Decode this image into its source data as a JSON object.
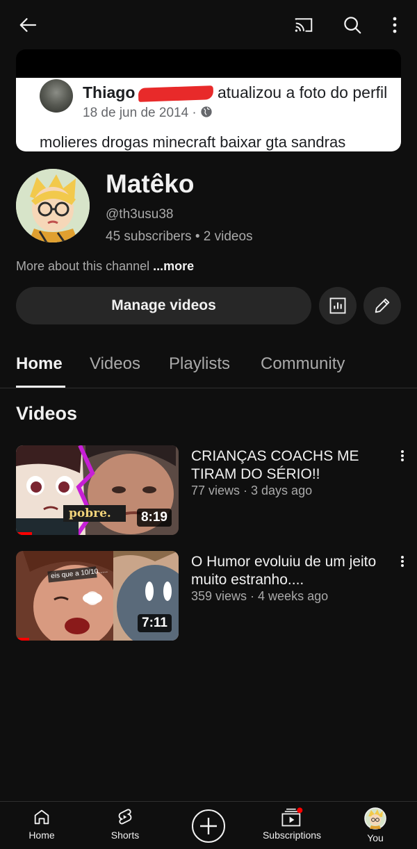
{
  "topbar": {
    "icons": [
      "back-arrow-icon",
      "cast-icon",
      "search-icon",
      "more-vert-icon"
    ]
  },
  "banner": {
    "post_name": "Thiago",
    "post_action": "atualizou a foto do perfil",
    "post_date": "18 de jun de 2014 ·",
    "post_text": "molieres drogas minecraft baixar gta sandras"
  },
  "channel": {
    "name": "Matêko",
    "handle": "@th3usu38",
    "stats": "45 subscribers • 2 videos",
    "more_about": "More about this channel",
    "more_link": "...more"
  },
  "actions": {
    "manage_videos": "Manage videos",
    "icons": [
      "analytics-icon",
      "edit-pencil-icon"
    ]
  },
  "tabs": [
    {
      "label": "Home"
    },
    {
      "label": "Videos"
    },
    {
      "label": "Playlists"
    },
    {
      "label": "Community"
    }
  ],
  "section": {
    "title": "Videos"
  },
  "videos": [
    {
      "title": "CRIANÇAS COACHS ME TIRAM DO SÉRIO!!",
      "meta": "77 views · 3 days ago",
      "duration": "8:19",
      "thumb_caption": "pobre.",
      "watched_fraction": 0.1
    },
    {
      "title": "O Humor evoluiu de um jeito muito estranho....",
      "meta": "359 views · 4 weeks ago",
      "duration": "7:11",
      "thumb_caption": "eis que a 10/10.....",
      "watched_fraction": 0.08
    }
  ],
  "bottom_nav": [
    {
      "label": "Home",
      "icon": "home-icon"
    },
    {
      "label": "Shorts",
      "icon": "shorts-icon"
    },
    {
      "label": "",
      "icon": "create-plus-icon"
    },
    {
      "label": "Subscriptions",
      "icon": "subscriptions-icon"
    },
    {
      "label": "You",
      "icon": "avatar-icon"
    }
  ],
  "colors": {
    "background": "#0f0f0f",
    "surface": "#272727",
    "text_primary": "#f1f1f1",
    "text_secondary": "#aaaaaa",
    "accent_red": "#ff0000"
  }
}
